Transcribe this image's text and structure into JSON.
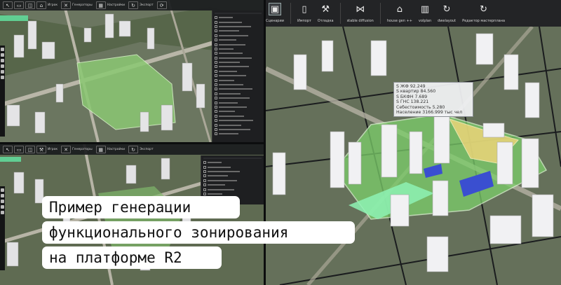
{
  "main_toolbar": {
    "items": [
      {
        "name": "scenarios",
        "label": "Сценарии",
        "icon": "layers-icon",
        "selected": true
      },
      {
        "name": "import",
        "label": "Импорт",
        "icon": "file-icon",
        "selected": false
      },
      {
        "name": "debug",
        "label": "Отладка",
        "icon": "wrench-icon",
        "selected": false
      },
      {
        "name": "stable-diffusion",
        "label": "stable diffusion",
        "icon": "network-icon",
        "selected": false
      },
      {
        "name": "house-gen",
        "label": "house gen ++",
        "icon": "home-icon",
        "selected": false
      },
      {
        "name": "volplan",
        "label": "volplan",
        "icon": "buildings-icon",
        "selected": false
      },
      {
        "name": "dwelayout",
        "label": "dwelayout",
        "icon": "recycle-icon",
        "selected": false
      },
      {
        "name": "masterplan-editor",
        "label": "Редактор мастерплана",
        "icon": "recycle-icon",
        "selected": false
      }
    ]
  },
  "top_left_toolbar": {
    "labels": [
      "Игрок",
      "Генераторы",
      "Настройки",
      "Экспорт"
    ]
  },
  "bottom_left_toolbar": {
    "labels": [
      "Игрок",
      "Генераторы",
      "Настройки",
      "Экспорт"
    ]
  },
  "tooltip": {
    "lines": [
      "S ЖФ 92.249",
      "S квартир 84.560",
      "S БКФН 7.689",
      "S ГНС 138.221",
      "Себестоимость 5.280",
      "Население 3166.999 тыс чел"
    ]
  },
  "caption": {
    "line1": "Пример генерации",
    "line2": "функционального зонирования",
    "line3": "на платформе R2"
  }
}
